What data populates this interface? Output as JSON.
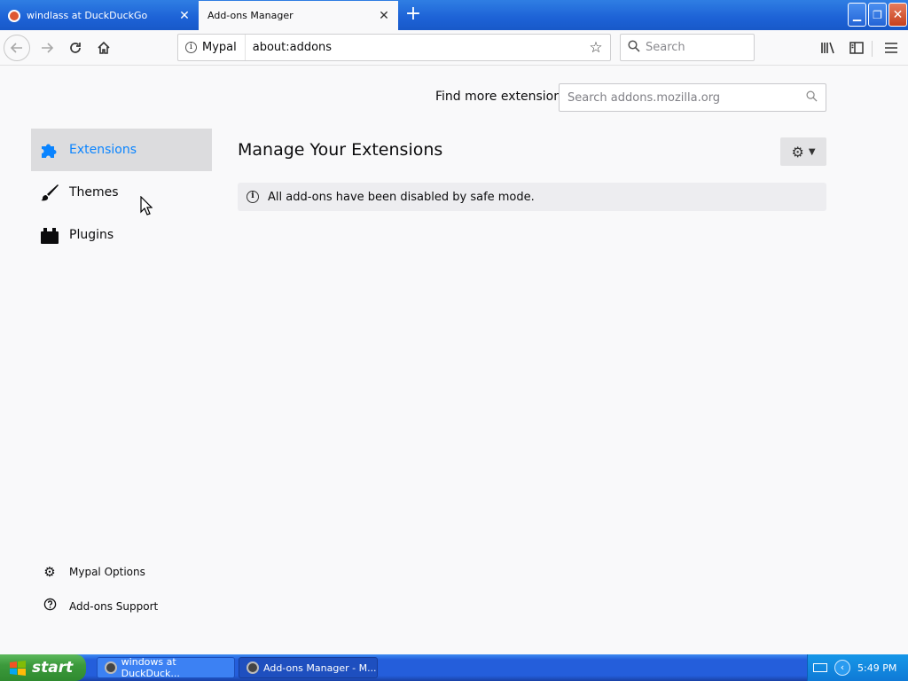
{
  "tabs": [
    {
      "title": "windlass at DuckDuckGo",
      "active": false
    },
    {
      "title": "Add-ons Manager",
      "active": true
    }
  ],
  "window_controls": {
    "minimize": "▁",
    "maximize": "❐",
    "close": "✕"
  },
  "navbar": {
    "identity_label": "Mypal",
    "url": "about:addons",
    "search_placeholder": "Search"
  },
  "content": {
    "find_more_label": "Find more extensions",
    "amo_search_placeholder": "Search addons.mozilla.org",
    "categories": [
      {
        "label": "Extensions",
        "icon": "puzzle-icon",
        "selected": true
      },
      {
        "label": "Themes",
        "icon": "brush-icon",
        "selected": false
      },
      {
        "label": "Plugins",
        "icon": "plugin-icon",
        "selected": false
      }
    ],
    "heading": "Manage Your Extensions",
    "safe_mode_message": "All add-ons have been disabled by safe mode.",
    "footer_links": [
      {
        "label": "Mypal Options",
        "icon": "gear-icon"
      },
      {
        "label": "Add-ons Support",
        "icon": "help-icon"
      }
    ]
  },
  "taskbar": {
    "start_label": "start",
    "tasks": [
      {
        "title": "windows at DuckDuck..."
      },
      {
        "title": "Add-ons Manager - M..."
      }
    ],
    "clock": "5:49 PM"
  },
  "colors": {
    "accent": "#0a84ff",
    "selected_bg": "#dcdcde",
    "titlebar": "#1d62d6"
  }
}
